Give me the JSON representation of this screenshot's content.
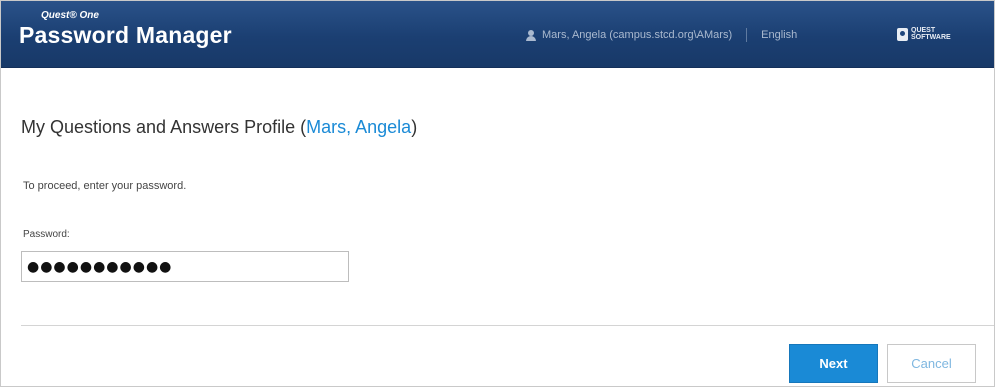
{
  "header": {
    "brand_sub": "Quest® One",
    "brand_main": "Password Manager",
    "user_label": "Mars, Angela (campus.stcd.org\\AMars)",
    "language": "English",
    "logo_text_line1": "QUEST",
    "logo_text_line2": "SOFTWARE"
  },
  "page": {
    "title_prefix": "My Questions and Answers Profile (",
    "title_name": "Mars, Angela",
    "title_suffix": ")",
    "instruction": "To proceed, enter your password."
  },
  "form": {
    "password_label": "Password:",
    "password_value": "●●●●●●●●●●●"
  },
  "buttons": {
    "next_label": "Next",
    "cancel_label": "Cancel"
  },
  "colors": {
    "header_bg": "#1f467c",
    "accent": "#1a8ad6"
  },
  "icons": {
    "user": "user-icon",
    "logo": "quest-software-logo"
  }
}
